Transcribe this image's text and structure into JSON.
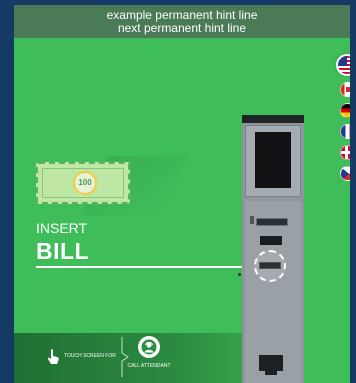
{
  "hint": {
    "line1": "example permanent hint line",
    "line2": "next permanent hint line"
  },
  "languages": [
    {
      "name": "us-flag-icon",
      "active": true
    },
    {
      "name": "canada-flag-icon",
      "active": false
    },
    {
      "name": "germany-flag-icon",
      "active": false
    },
    {
      "name": "france-flag-icon",
      "active": false
    },
    {
      "name": "denmark-flag-icon",
      "active": false
    },
    {
      "name": "czech-flag-icon",
      "active": false
    }
  ],
  "bill_graphic": {
    "denomination": "100"
  },
  "prompt": {
    "insert_label": "INSERT",
    "item_label": "BILL"
  },
  "footer": {
    "touch_label": "TOUCH SCREEN FOR",
    "call_label": "CALL ATTENDANT"
  },
  "colors": {
    "screen_bg": "#3fbd59",
    "hint_bar": "#4b7a57",
    "frame": "#163a66"
  }
}
